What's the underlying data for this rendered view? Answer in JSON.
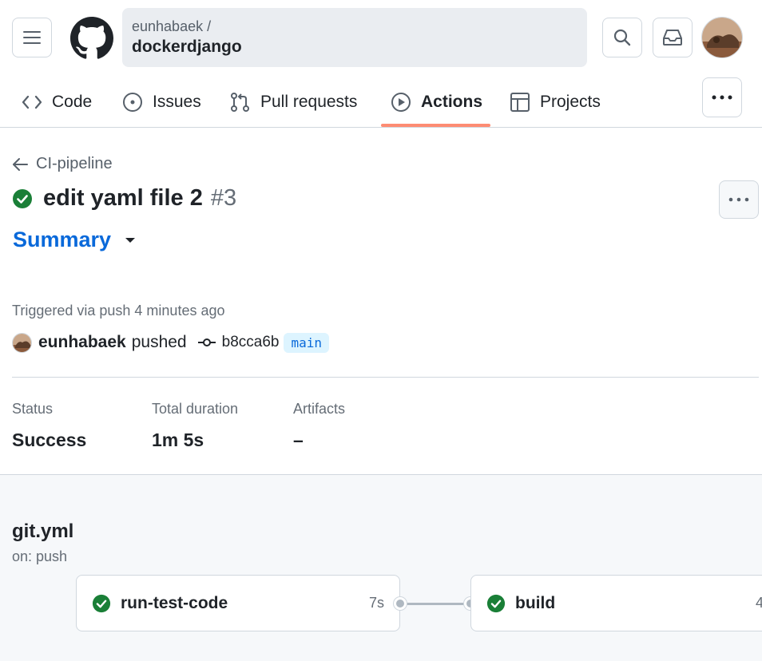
{
  "header": {
    "repo_owner": "eunhabaek /",
    "repo_name": "dockerdjango"
  },
  "tabs": [
    {
      "label": "Code",
      "icon": "code-icon"
    },
    {
      "label": "Issues",
      "icon": "issue-opened-icon"
    },
    {
      "label": "Pull requests",
      "icon": "git-pull-request-icon"
    },
    {
      "label": "Actions",
      "icon": "play-icon",
      "active": true
    },
    {
      "label": "Projects",
      "icon": "table-icon"
    }
  ],
  "run": {
    "workflow_back_label": "CI-pipeline",
    "title": "edit yaml file 2",
    "number": "#3",
    "status_icon": "check-circle-fill-icon",
    "summary_label": "Summary",
    "triggered": "Triggered via push 4 minutes ago",
    "actor": "eunhabaek",
    "action": "pushed",
    "commit_sha": "b8cca6b",
    "branch": "main"
  },
  "stats": {
    "status_label": "Status",
    "status_value": "Success",
    "duration_label": "Total duration",
    "duration_value": "1m 5s",
    "artifacts_label": "Artifacts",
    "artifacts_value": "–"
  },
  "workflow": {
    "name": "git.yml",
    "trigger": "on: push",
    "jobs": [
      {
        "name": "run-test-code",
        "duration": "7s"
      },
      {
        "name": "build",
        "duration": "4"
      }
    ]
  },
  "colors": {
    "success": "#1a7f37",
    "link": "#0969da",
    "tab_underline": "#fd8c73"
  }
}
